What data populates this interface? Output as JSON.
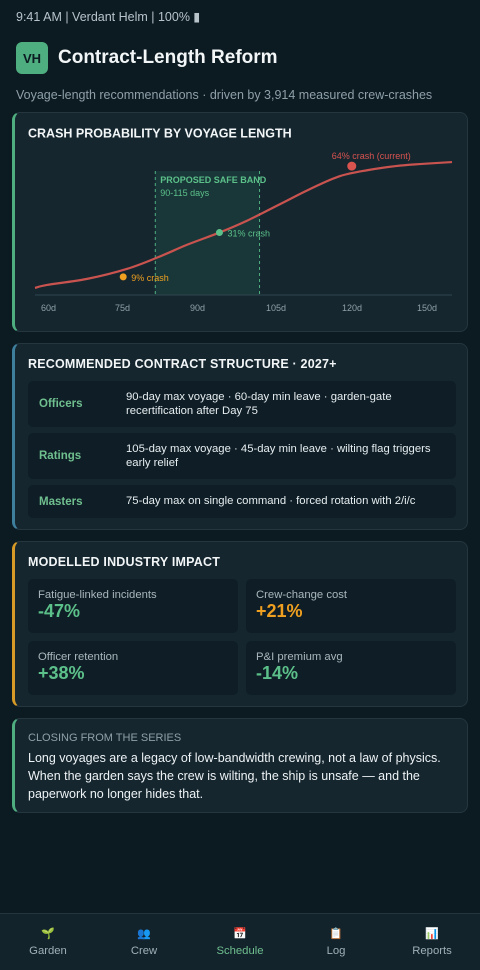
{
  "status_bar": "9:41 AM | Verdant Helm | 100% ▮",
  "app": {
    "logo": "VH",
    "title": "Contract-Length Reform",
    "subtitle": "Voyage-length recommendations · driven by 3,914 measured crew-crashes"
  },
  "chart_title": "CRASH PROBABILITY BY VOYAGE LENGTH",
  "chart_data": {
    "type": "line",
    "x_unit": "days",
    "x_ticks": [
      "60d",
      "75d",
      "90d",
      "105d",
      "120d",
      "150d"
    ],
    "series": [
      {
        "points": [
          [
            57,
            0.035
          ],
          [
            60,
            0.05
          ],
          [
            70,
            0.08
          ],
          [
            80,
            0.13
          ],
          [
            88,
            0.19
          ],
          [
            95,
            0.25
          ],
          [
            103,
            0.31
          ],
          [
            110,
            0.37
          ],
          [
            118,
            0.45
          ],
          [
            126,
            0.53
          ],
          [
            133,
            0.59
          ],
          [
            140,
            0.62
          ],
          [
            147,
            0.64
          ],
          [
            153,
            0.65
          ],
          [
            161,
            0.66
          ]
        ]
      }
    ],
    "band": {
      "label": "PROPOSED SAFE BAND",
      "sublabel": "90-115 days",
      "x_start": 87,
      "x_end": 113
    },
    "markers": [
      {
        "x": 79,
        "y": 0.09,
        "label": "9% crash",
        "color": "#f0a020"
      },
      {
        "x": 103,
        "y": 0.31,
        "label": "31% crash",
        "color": "#5cc08a"
      },
      {
        "x": 136,
        "y": 0.64,
        "label": "64% crash (current)",
        "color": "#d9534f"
      }
    ],
    "line_color": "#c9534f"
  },
  "structure": {
    "title": "RECOMMENDED CONTRACT STRUCTURE · 2027+",
    "rows": [
      {
        "role": "Officers",
        "desc": "90-day max voyage · 60-day min leave · garden-gate recertification after Day 75"
      },
      {
        "role": "Ratings",
        "desc": "105-day max voyage · 45-day min leave · wilting flag triggers early relief"
      },
      {
        "role": "Masters",
        "desc": "75-day max on single command · forced rotation with 2/i/c"
      }
    ]
  },
  "impact": {
    "title": "MODELLED INDUSTRY IMPACT",
    "tiles": [
      {
        "label": "Fatigue-linked incidents",
        "value": "-47%",
        "color": "#5cc08a"
      },
      {
        "label": "Crew-change cost",
        "value": "+21%",
        "color": "#f0a020"
      },
      {
        "label": "Officer retention",
        "value": "+38%",
        "color": "#5cc08a"
      },
      {
        "label": "P&I premium avg",
        "value": "-14%",
        "color": "#5cc08a"
      }
    ]
  },
  "closing": {
    "label": "CLOSING FROM THE SERIES",
    "text": "Long voyages are a legacy of low-bandwidth crewing, not a law of physics. When the garden says the crew is wilting, the ship is unsafe — and the paperwork no longer hides that."
  },
  "tabs": [
    {
      "icon": "🌱",
      "icon_name": "sprout-icon",
      "label": "Garden"
    },
    {
      "icon": "👥",
      "icon_name": "crew-icon",
      "label": "Crew"
    },
    {
      "icon": "📅",
      "icon_name": "calendar-icon",
      "label": "Schedule",
      "active": true
    },
    {
      "icon": "📋",
      "icon_name": "clipboard-icon",
      "label": "Log"
    },
    {
      "icon": "📊",
      "icon_name": "chart-icon",
      "label": "Reports"
    }
  ]
}
